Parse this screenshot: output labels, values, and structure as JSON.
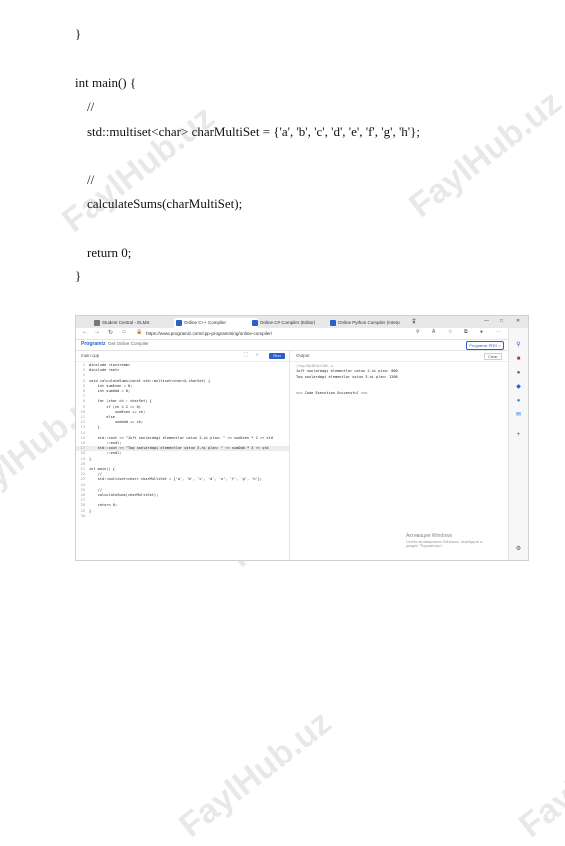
{
  "doc_code": {
    "lines": [
      "}",
      "int main() {",
      "//",
      "std::multiset<char> charMultiSet = {'a', 'b', 'c', 'd', 'e', 'f', 'g', 'h'};",
      "//",
      "calculateSums(charMultiSet);",
      "return 0;",
      "}"
    ]
  },
  "watermark": "FaylHub.uz",
  "browser": {
    "tabs": [
      {
        "label": "Student Central - ELMS",
        "color": "#777777"
      },
      {
        "label": "Online C++ Compiler",
        "color": "#2b5ec9"
      },
      {
        "label": "Online C# Compiler (Editor)",
        "color": "#2b5ec9"
      },
      {
        "label": "Online Python Compiler (Interp",
        "color": "#2b5ec9"
      }
    ],
    "new_tab": "+",
    "window_controls": [
      "—",
      "□",
      "✕"
    ],
    "url": "https://www.programiz.com/cpp-programming/online-compiler/"
  },
  "site": {
    "logo": "Programiz",
    "get_app": "Get Online Compiler",
    "pro_button": "Programiz PRO >"
  },
  "editor": {
    "file_name": "main.cpp",
    "run_label": "Run",
    "highlighted_line": 16,
    "lines": [
      "#include <iostream>",
      "#include <set>",
      "",
      "void calculateSums(const std::multiset<char>& charSet) {",
      "    int sumEven = 0;",
      "    int sumOdd = 0;",
      "",
      "    for (char ch : charSet) {",
      "        if (ch % 2 == 0)",
      "            sumEven += ch;",
      "        else",
      "            sumOdd += ch;",
      "    }",
      "",
      "    std::cout << \"Juft sonlardagi elementlar ustun 2-ni plan: \" << sumEven * 2 << std",
      "        ::endl;",
      "    std::cout << \"Toq sonlardagi elementlar ustun 3-ni plan: \" << sumOdd * 3 << std",
      "        ::endl;",
      "}",
      "",
      "int main() {",
      "    //",
      "    std::multiset<char> charMultiSet = {'a', 'b', 'c', 'd', 'e', 'f', 'g', 'h'};",
      "",
      "    //",
      "    calculateSums(charMultiSet);",
      "",
      "    return 0;",
      "}",
      ""
    ]
  },
  "output": {
    "label": "Output",
    "clear_label": "Clear",
    "lines": [
      "/tmp/Bp3KHytZ6h.o",
      "Juft sonlardagi elementlar ustun 2-ni plan: 800",
      "Toq sonlardagi elementlar ustun 3-ni plan: 1206",
      "",
      "",
      "=== Code Execution Successful ==="
    ],
    "activation_title": "Активация Windows",
    "activation_text": "Чтобы активировать Windows, перейдите в\nраздел \"Параметры\"."
  },
  "colors": {
    "accent": "#2b5ec9",
    "tab_bar": "#e8e8e8"
  }
}
